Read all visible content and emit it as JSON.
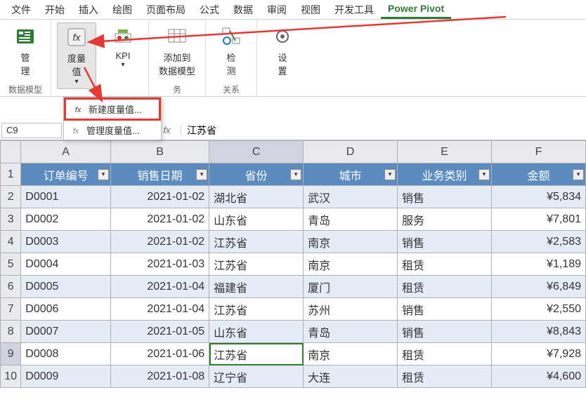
{
  "menu": {
    "file": "文件",
    "home": "开始",
    "insert": "插入",
    "draw": "绘图",
    "layout": "页面布局",
    "formulas": "公式",
    "data": "数据",
    "review": "审阅",
    "view": "视图",
    "dev": "开发工具",
    "powerpivot": "Power Pivot"
  },
  "ribbon": {
    "manage": "管\n理",
    "measure": "度量\n值",
    "kpi": "KPI",
    "add_to_model": "添加到\n数据模型",
    "detect": "检\n测",
    "settings": "设\n置",
    "group1": "数据模型",
    "group2": "",
    "group3": "务",
    "group4": "关系"
  },
  "dropdown": {
    "new_measure": "新建度量值...",
    "manage_measure": "管理度量值..."
  },
  "namebox": "C9",
  "fx_label": "fx",
  "formula_value": "江苏省",
  "col_headers": [
    "A",
    "B",
    "C",
    "D",
    "E",
    "F"
  ],
  "data_headers": {
    "c1": "订单编号",
    "c2": "销售日期",
    "c3": "省份",
    "c4": "城市",
    "c5": "业务类别",
    "c6": "金额"
  },
  "rows": [
    {
      "n": "2",
      "id": "D0001",
      "date": "2021-01-02",
      "prov": "湖北省",
      "city": "武汉",
      "type": "销售",
      "amt": "¥5,834"
    },
    {
      "n": "3",
      "id": "D0002",
      "date": "2021-01-02",
      "prov": "山东省",
      "city": "青岛",
      "type": "服务",
      "amt": "¥7,801"
    },
    {
      "n": "4",
      "id": "D0003",
      "date": "2021-01-02",
      "prov": "江苏省",
      "city": "南京",
      "type": "销售",
      "amt": "¥2,583"
    },
    {
      "n": "5",
      "id": "D0004",
      "date": "2021-01-03",
      "prov": "江苏省",
      "city": "南京",
      "type": "租赁",
      "amt": "¥1,189"
    },
    {
      "n": "6",
      "id": "D0005",
      "date": "2021-01-04",
      "prov": "福建省",
      "city": "厦门",
      "type": "租赁",
      "amt": "¥6,849"
    },
    {
      "n": "7",
      "id": "D0006",
      "date": "2021-01-04",
      "prov": "江苏省",
      "city": "苏州",
      "type": "销售",
      "amt": "¥2,550"
    },
    {
      "n": "8",
      "id": "D0007",
      "date": "2021-01-05",
      "prov": "山东省",
      "city": "青岛",
      "type": "销售",
      "amt": "¥8,843"
    },
    {
      "n": "9",
      "id": "D0008",
      "date": "2021-01-06",
      "prov": "江苏省",
      "city": "南京",
      "type": "租赁",
      "amt": "¥7,928"
    },
    {
      "n": "10",
      "id": "D0009",
      "date": "2021-01-08",
      "prov": "辽宁省",
      "city": "大连",
      "type": "租赁",
      "amt": "¥4,600"
    }
  ]
}
